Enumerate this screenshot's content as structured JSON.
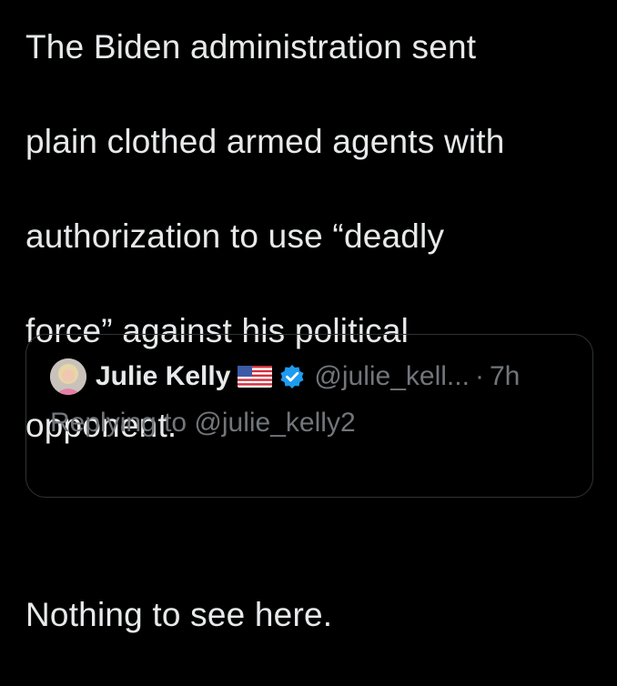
{
  "tweet": {
    "lines": [
      "The Biden administration sent",
      "plain clothed armed agents with",
      "authorization to use “deadly",
      "force” against his political",
      "opponent.",
      "Nothing to see here."
    ]
  },
  "quoted_tweet": {
    "display_name": "Julie Kelly",
    "handle": "@julie_kell...",
    "separator": "·",
    "age": "7h",
    "replying_to": "Replying to @julie_kelly2",
    "flag_icon": "us-flag-icon",
    "verified_icon": "verified-badge-icon",
    "verified_color": "#1d9bf0"
  },
  "colors": {
    "background": "#000000",
    "text": "#e7e9ea",
    "muted": "#71767b",
    "border": "#2f3336"
  }
}
